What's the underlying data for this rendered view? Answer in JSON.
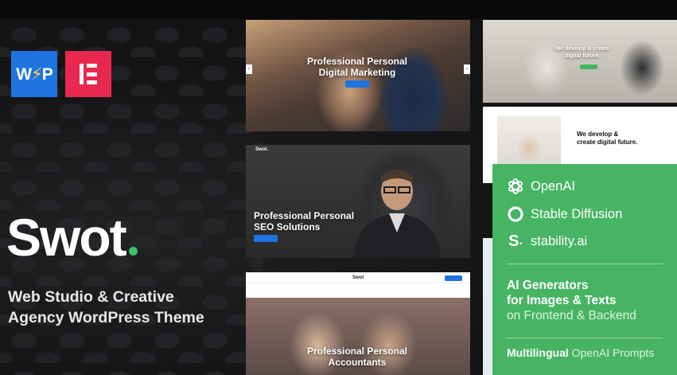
{
  "brand": {
    "name": "Swot",
    "tagline_line1": "Web Studio & Creative",
    "tagline_line2": "Agency WordPress Theme",
    "accent_dot_color": "#3fbf6f"
  },
  "badges": [
    {
      "name": "wpbakery-badge",
      "label_a": "W",
      "label_b": "P",
      "color": "#1f74e0"
    },
    {
      "name": "elementor-badge",
      "color": "#e8284f"
    }
  ],
  "previews": {
    "digital_marketing": {
      "line1": "Professional Personal",
      "line2": "Digital Marketing"
    },
    "seo": {
      "nav_logo": "Swot.",
      "line1": "Professional Personal",
      "line2": "SEO Solutions"
    },
    "accountants": {
      "nav_logo": "Swot",
      "line1": "Professional Personal",
      "line2": "Accountants"
    },
    "team": {
      "line1": "We develop & create",
      "line2": "digital future."
    },
    "develop": {
      "line1": "We develop &",
      "line2": "create digital future."
    }
  },
  "ai_panel": {
    "bg_color": "#47b464",
    "providers": [
      {
        "icon": "openai-icon",
        "label": "OpenAI"
      },
      {
        "icon": "stable-diffusion-icon",
        "label": "Stable Diffusion"
      },
      {
        "icon": "stability-ai-icon",
        "label": "stability.ai"
      }
    ],
    "feature_line1": "AI Generators",
    "feature_line2": "for Images & Texts",
    "feature_line3": "on Frontend & Backend",
    "footer_bold": "Multilingual",
    "footer_rest": "OpenAI Prompts"
  }
}
